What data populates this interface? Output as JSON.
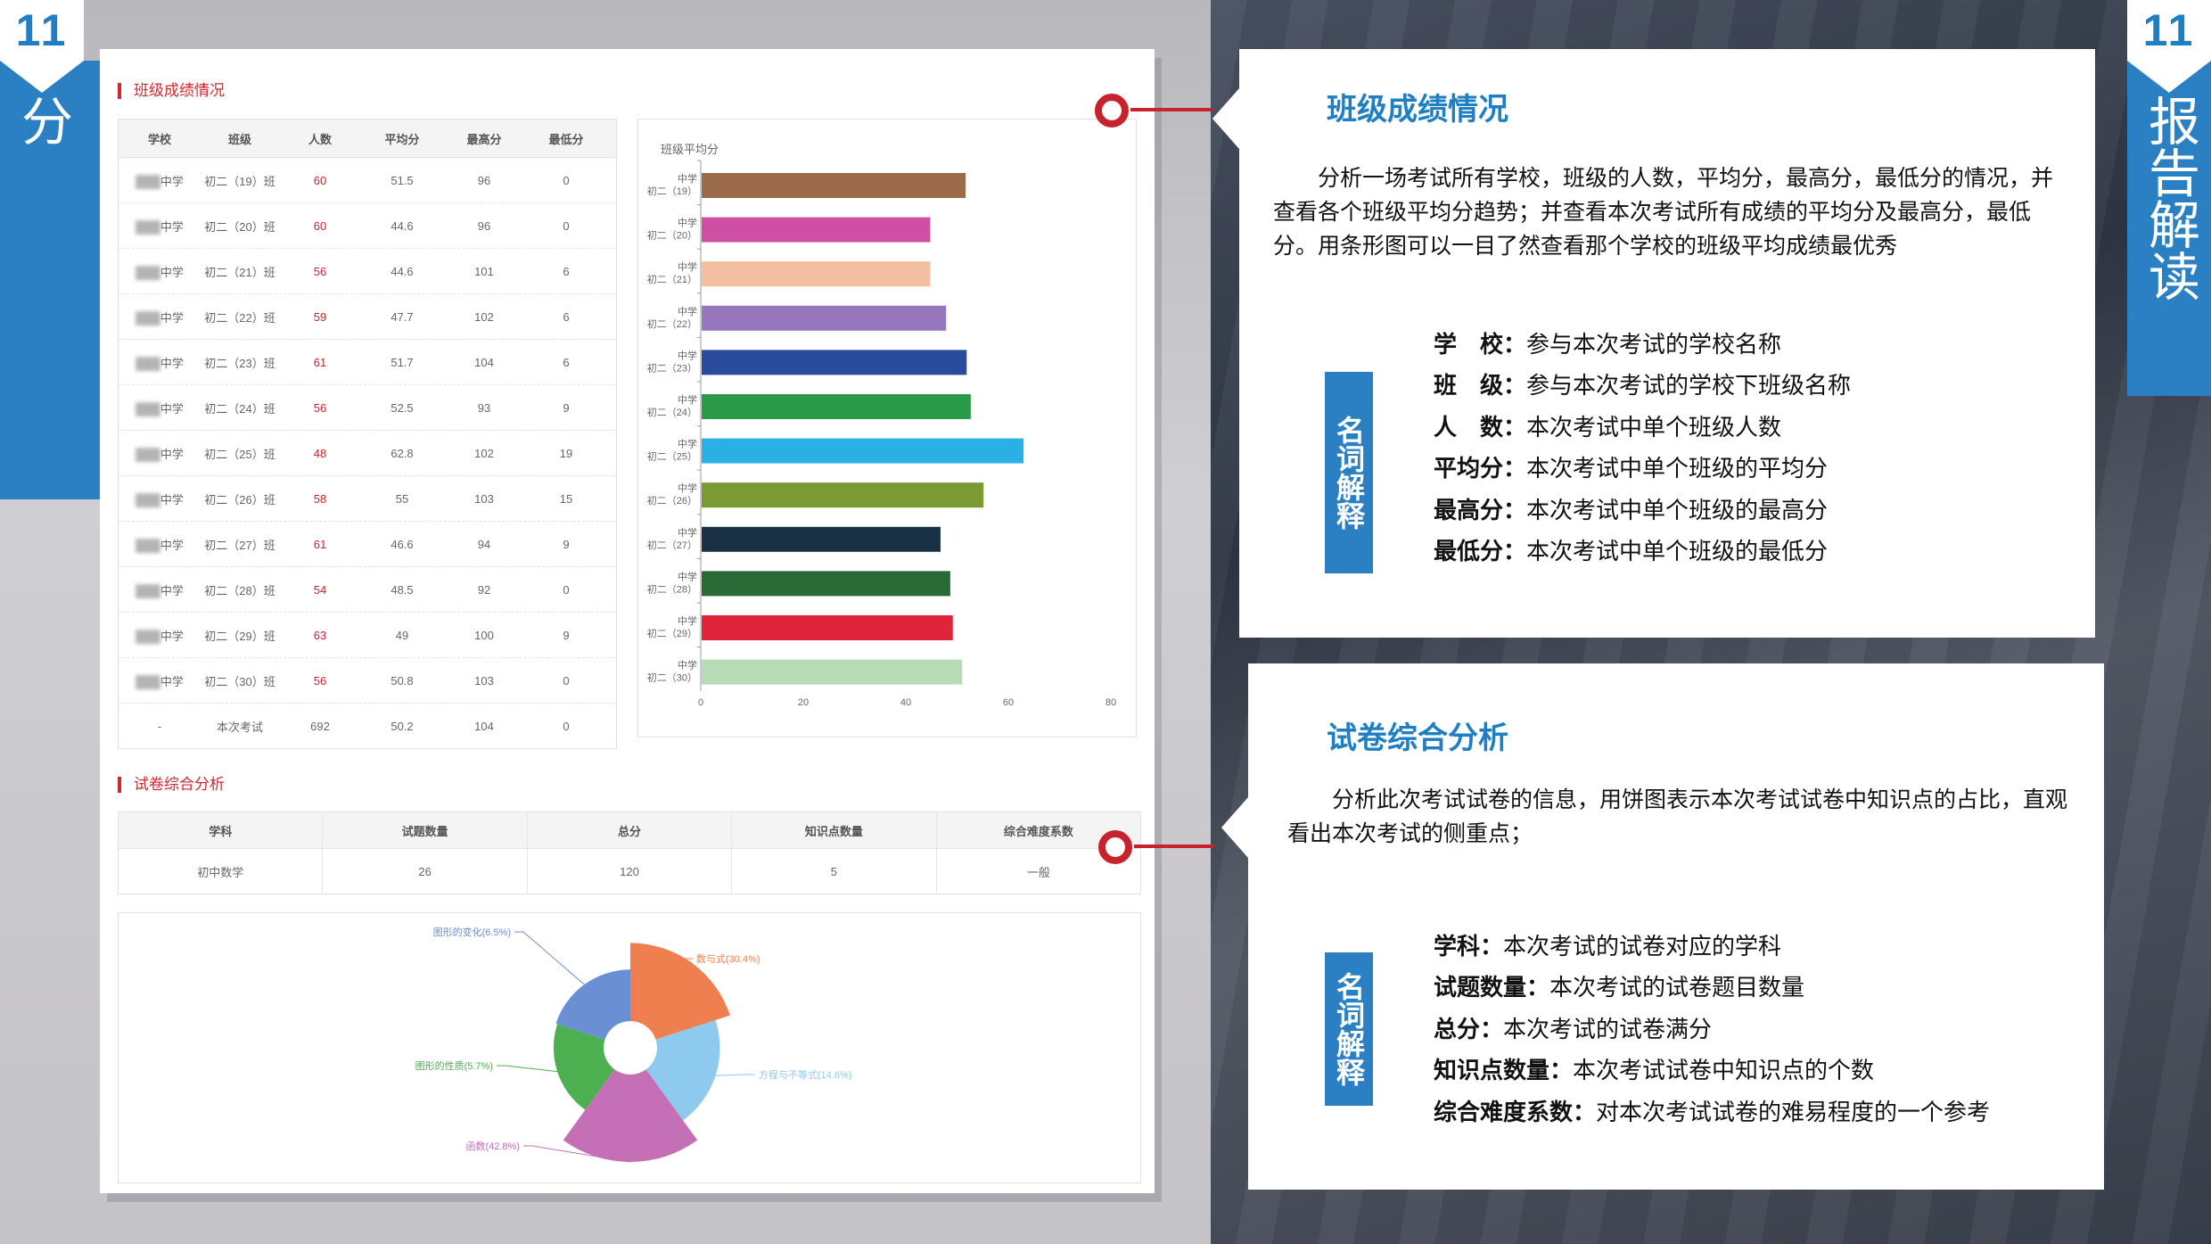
{
  "left_tab": {
    "number": "11",
    "label": "群体分析报告部分"
  },
  "right_tab": {
    "number": "11",
    "label": "报告解读"
  },
  "screenshot": {
    "section1_title": "班级成绩情况",
    "table1": {
      "headers": [
        "学校",
        "班级",
        "人数",
        "平均分",
        "最高分",
        "最低分"
      ],
      "rows": [
        [
          "中学",
          "初二（19）班",
          "60",
          "51.5",
          "96",
          "0"
        ],
        [
          "中学",
          "初二（20）班",
          "60",
          "44.6",
          "96",
          "0"
        ],
        [
          "中学",
          "初二（21）班",
          "56",
          "44.6",
          "101",
          "6"
        ],
        [
          "中学",
          "初二（22）班",
          "59",
          "47.7",
          "102",
          "6"
        ],
        [
          "中学",
          "初二（23）班",
          "61",
          "51.7",
          "104",
          "6"
        ],
        [
          "中学",
          "初二（24）班",
          "56",
          "52.5",
          "93",
          "9"
        ],
        [
          "中学",
          "初二（25）班",
          "48",
          "62.8",
          "102",
          "19"
        ],
        [
          "中学",
          "初二（26）班",
          "58",
          "55",
          "103",
          "15"
        ],
        [
          "中学",
          "初二（27）班",
          "61",
          "46.6",
          "94",
          "9"
        ],
        [
          "中学",
          "初二（28）班",
          "54",
          "48.5",
          "92",
          "0"
        ],
        [
          "中学",
          "初二（29）班",
          "63",
          "49",
          "100",
          "9"
        ],
        [
          "中学",
          "初二（30）班",
          "56",
          "50.8",
          "103",
          "0"
        ]
      ],
      "total_row": [
        "-",
        "本次考试",
        "692",
        "50.2",
        "104",
        "0"
      ]
    },
    "section2_title": "试卷综合分析",
    "table2": {
      "headers": [
        "学科",
        "试题数量",
        "总分",
        "知识点数量",
        "综合难度系数"
      ],
      "row": [
        "初中数学",
        "26",
        "120",
        "5",
        "一般"
      ]
    }
  },
  "chart_data": [
    {
      "type": "bar",
      "orientation": "horizontal",
      "title": "班级平均分",
      "categories": [
        "初二（19）",
        "初二（20）",
        "初二（21）",
        "初二（22）",
        "初二（23）",
        "初二（24）",
        "初二（25）",
        "初二（26）",
        "初二（27）",
        "初二（28）",
        "初二（29）",
        "初二（30）"
      ],
      "category_prefix": "中学",
      "values": [
        51.5,
        44.6,
        44.6,
        47.7,
        51.7,
        52.5,
        62.8,
        55,
        46.6,
        48.5,
        49,
        50.8
      ],
      "colors": [
        "#9b6a48",
        "#cf4fa4",
        "#f4bfa1",
        "#9677be",
        "#2a4a9c",
        "#2b9a48",
        "#2bb0e6",
        "#7a9a34",
        "#1a3045",
        "#2a6a36",
        "#e0253a",
        "#b5dcb6"
      ],
      "xlim": [
        0,
        80
      ],
      "xticks": [
        0,
        20,
        40,
        60,
        80
      ]
    },
    {
      "type": "pie",
      "style": "nightingale-rose",
      "slices": [
        {
          "label": "数与式(30.4%)",
          "value": 30.4,
          "color": "#f07f4f"
        },
        {
          "label": "方程与不等式(14.6%)",
          "value": 14.6,
          "color": "#8ec9ee"
        },
        {
          "label": "函数(42.8%)",
          "value": 42.8,
          "color": "#c56fb6"
        },
        {
          "label": "图形的性质(5.7%)",
          "value": 5.7,
          "color": "#4caf50"
        },
        {
          "label": "图形的变化(6.5%)",
          "value": 6.5,
          "color": "#6a8fd2"
        }
      ]
    }
  ],
  "card1": {
    "title": "班级成绩情况",
    "paragraph": "分析一场考试所有学校，班级的人数，平均分，最高分，最低分的情况，并查看各个班级平均分趋势；并查看本次考试所有成绩的平均分及最高分，最低分。用条形图可以一目了然查看那个学校的班级平均成绩最优秀",
    "badge": "名词解释",
    "terms": [
      {
        "key": "学　校：",
        "desc": "参与本次考试的学校名称"
      },
      {
        "key": "班　级：",
        "desc": "参与本次考试的学校下班级名称"
      },
      {
        "key": "人　数：",
        "desc": "本次考试中单个班级人数"
      },
      {
        "key": "平均分：",
        "desc": "本次考试中单个班级的平均分"
      },
      {
        "key": "最高分：",
        "desc": "本次考试中单个班级的最高分"
      },
      {
        "key": "最低分：",
        "desc": "本次考试中单个班级的最低分"
      }
    ]
  },
  "card2": {
    "title": "试卷综合分析",
    "paragraph": "分析此次考试试卷的信息，用饼图表示本次考试试卷中知识点的占比，直观看出本次考试的侧重点；",
    "badge": "名词解释",
    "terms": [
      {
        "key": "学科：",
        "desc": "本次考试的试卷对应的学科"
      },
      {
        "key": "试题数量：",
        "desc": "本次考试的试卷题目数量"
      },
      {
        "key": "总分：",
        "desc": "本次考试的试卷满分"
      },
      {
        "key": "知识点数量：",
        "desc": "本次考试试卷中知识点的个数"
      },
      {
        "key": "综合难度系数：",
        "desc": "对本次考试试卷的难易程度的一个参考"
      }
    ]
  }
}
